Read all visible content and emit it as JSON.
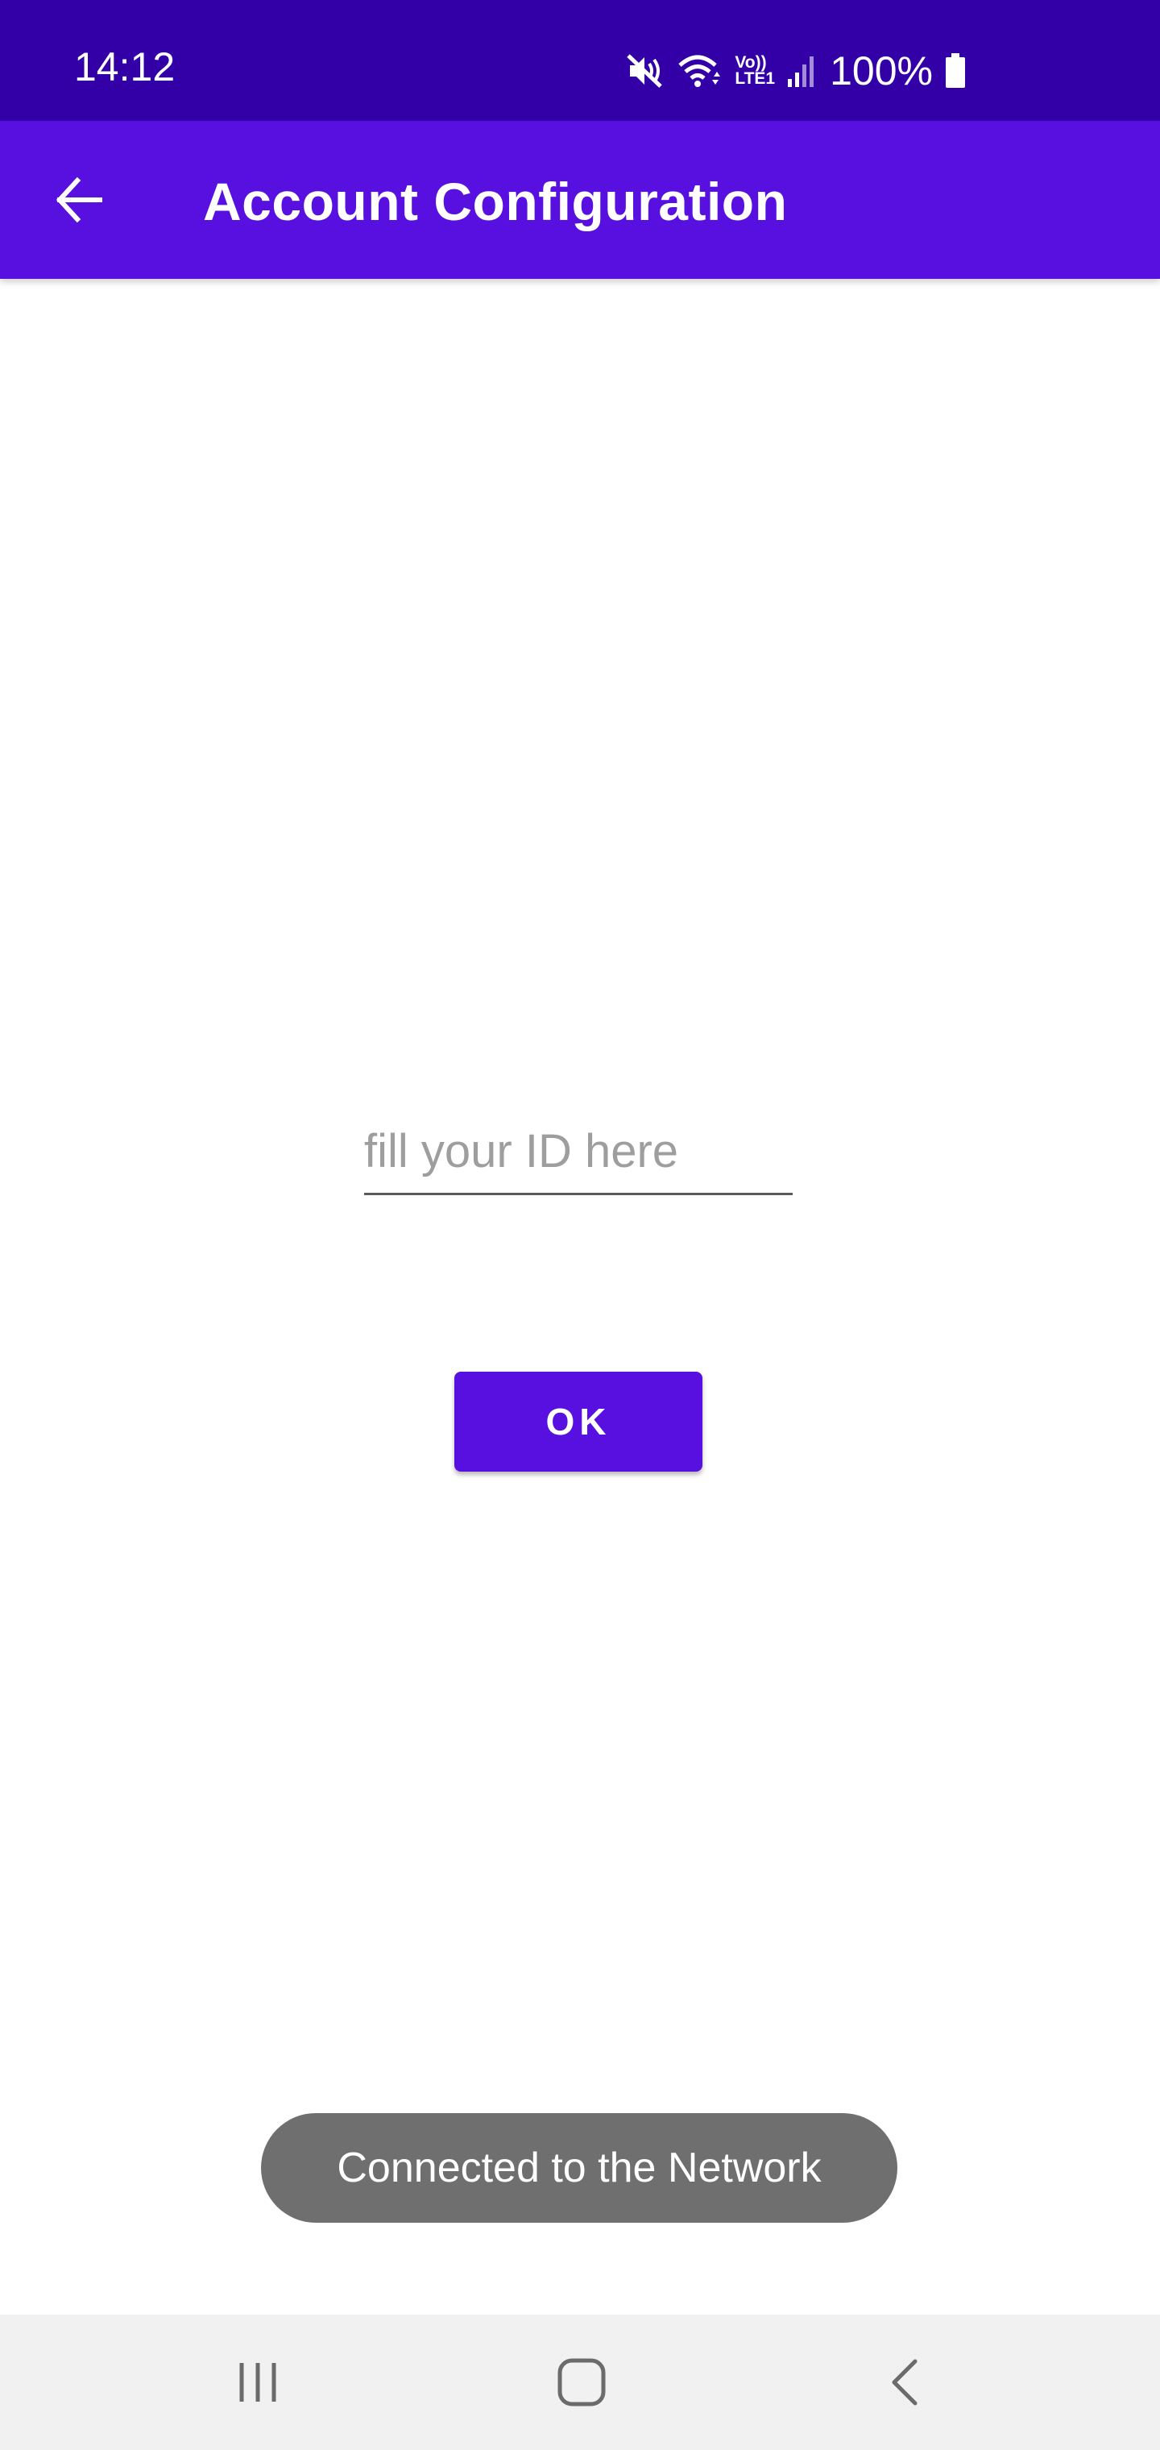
{
  "status_bar": {
    "time": "14:12",
    "battery_percent": "100%",
    "icons": [
      "mute-icon",
      "wifi-icon",
      "volte-icon",
      "signal-icon",
      "battery-icon"
    ],
    "volte_label_top": "Vo))",
    "volte_label_bottom": "LTE1",
    "background_color": "#3300a8"
  },
  "app_bar": {
    "title": "Account Configuration",
    "back_icon": "arrow-back-icon",
    "background_color": "#5810e0"
  },
  "form": {
    "id_input": {
      "placeholder": "fill your ID here",
      "value": ""
    },
    "ok_button_label": "OK",
    "button_color": "#5810e0"
  },
  "toast": {
    "message": "Connected to the Network"
  },
  "nav_bar": {
    "recents_icon": "recents-icon",
    "home_icon": "home-icon",
    "back_icon": "back-chevron-icon"
  }
}
